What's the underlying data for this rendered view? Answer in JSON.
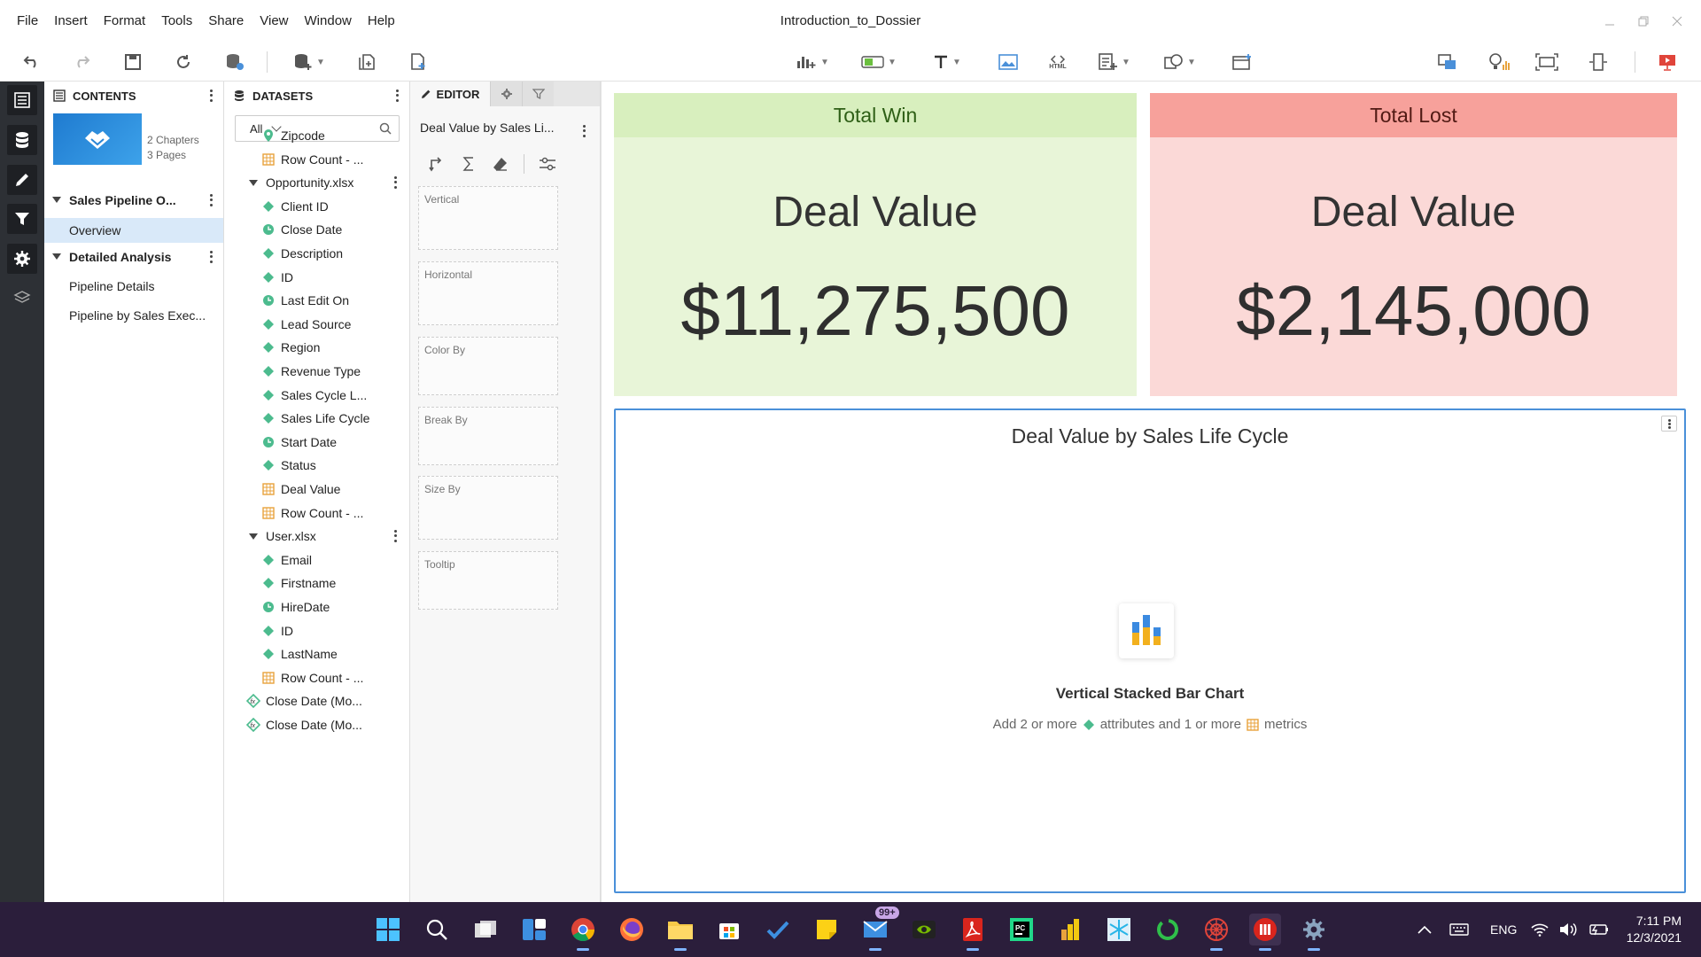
{
  "menu": {
    "items": [
      "File",
      "Insert",
      "Format",
      "Tools",
      "Share",
      "View",
      "Window",
      "Help"
    ],
    "window_title": "Introduction_to_Dossier"
  },
  "toolbar": {
    "html_label": "HTML"
  },
  "contents": {
    "header": "CONTENTS",
    "chapters_count": "2 Chapters",
    "pages_count": "3 Pages",
    "chapters": [
      {
        "title": "Sales Pipeline O...",
        "pages": [
          "Overview"
        ]
      },
      {
        "title": "Detailed Analysis",
        "pages": [
          "Pipeline Details",
          "Pipeline by Sales Exec..."
        ]
      }
    ]
  },
  "datasets": {
    "header": "DATASETS",
    "filter_value": "All",
    "rows": [
      {
        "type": "geo",
        "label": "Zipcode",
        "indent": 1
      },
      {
        "type": "metric",
        "label": "Row Count - ...",
        "indent": 1
      },
      {
        "type": "dataset",
        "label": "Opportunity.xlsx",
        "indent": 0
      },
      {
        "type": "attribute",
        "label": "Client ID",
        "indent": 1
      },
      {
        "type": "date",
        "label": "Close Date",
        "indent": 1
      },
      {
        "type": "attribute",
        "label": "Description",
        "indent": 1
      },
      {
        "type": "attribute",
        "label": "ID",
        "indent": 1
      },
      {
        "type": "date",
        "label": "Last Edit On",
        "indent": 1
      },
      {
        "type": "attribute",
        "label": "Lead Source",
        "indent": 1
      },
      {
        "type": "attribute",
        "label": "Region",
        "indent": 1
      },
      {
        "type": "attribute",
        "label": "Revenue Type",
        "indent": 1
      },
      {
        "type": "attribute",
        "label": "Sales Cycle L...",
        "indent": 1
      },
      {
        "type": "attribute",
        "label": "Sales Life Cycle",
        "indent": 1
      },
      {
        "type": "date",
        "label": "Start Date",
        "indent": 1
      },
      {
        "type": "attribute",
        "label": "Status",
        "indent": 1
      },
      {
        "type": "metric",
        "label": "Deal Value",
        "indent": 1
      },
      {
        "type": "metric",
        "label": "Row Count - ...",
        "indent": 1
      },
      {
        "type": "dataset",
        "label": "User.xlsx",
        "indent": 0
      },
      {
        "type": "attribute",
        "label": "Email",
        "indent": 1
      },
      {
        "type": "attribute",
        "label": "Firstname",
        "indent": 1
      },
      {
        "type": "date",
        "label": "HireDate",
        "indent": 1
      },
      {
        "type": "attribute",
        "label": "ID",
        "indent": 1
      },
      {
        "type": "attribute",
        "label": "LastName",
        "indent": 1
      },
      {
        "type": "metric",
        "label": "Row Count - ...",
        "indent": 1
      },
      {
        "type": "derived",
        "label": "Close Date (Mo...",
        "indent": 0
      },
      {
        "type": "derived",
        "label": "Close Date (Mo...",
        "indent": 0
      }
    ]
  },
  "editor": {
    "tab_label": "EDITOR",
    "viz_title": "Deal Value by Sales Li...",
    "zones": [
      "Vertical",
      "Horizontal",
      "Color By",
      "Break By",
      "Size By",
      "Tooltip"
    ]
  },
  "kpis": {
    "win": {
      "header": "Total Win",
      "label": "Deal Value",
      "value": "$11,275,500"
    },
    "lost": {
      "header": "Total Lost",
      "label": "Deal Value",
      "value": "$2,145,000"
    }
  },
  "chart": {
    "title": "Deal Value by Sales Life Cycle",
    "placeholder_title": "Vertical Stacked Bar Chart",
    "hint_part1": "Add 2 or more",
    "hint_part2": "attributes and 1 or more",
    "hint_part3": "metrics"
  },
  "taskbar": {
    "mail_badge": "99+",
    "language": "ENG",
    "time": "7:11 PM",
    "date": "12/3/2021"
  },
  "colors": {
    "win_header": "#d8efbe",
    "lost_header": "#f7a19b",
    "attribute": "#4cbb8e",
    "metric": "#e8a33d",
    "accent": "#4a90d9"
  }
}
